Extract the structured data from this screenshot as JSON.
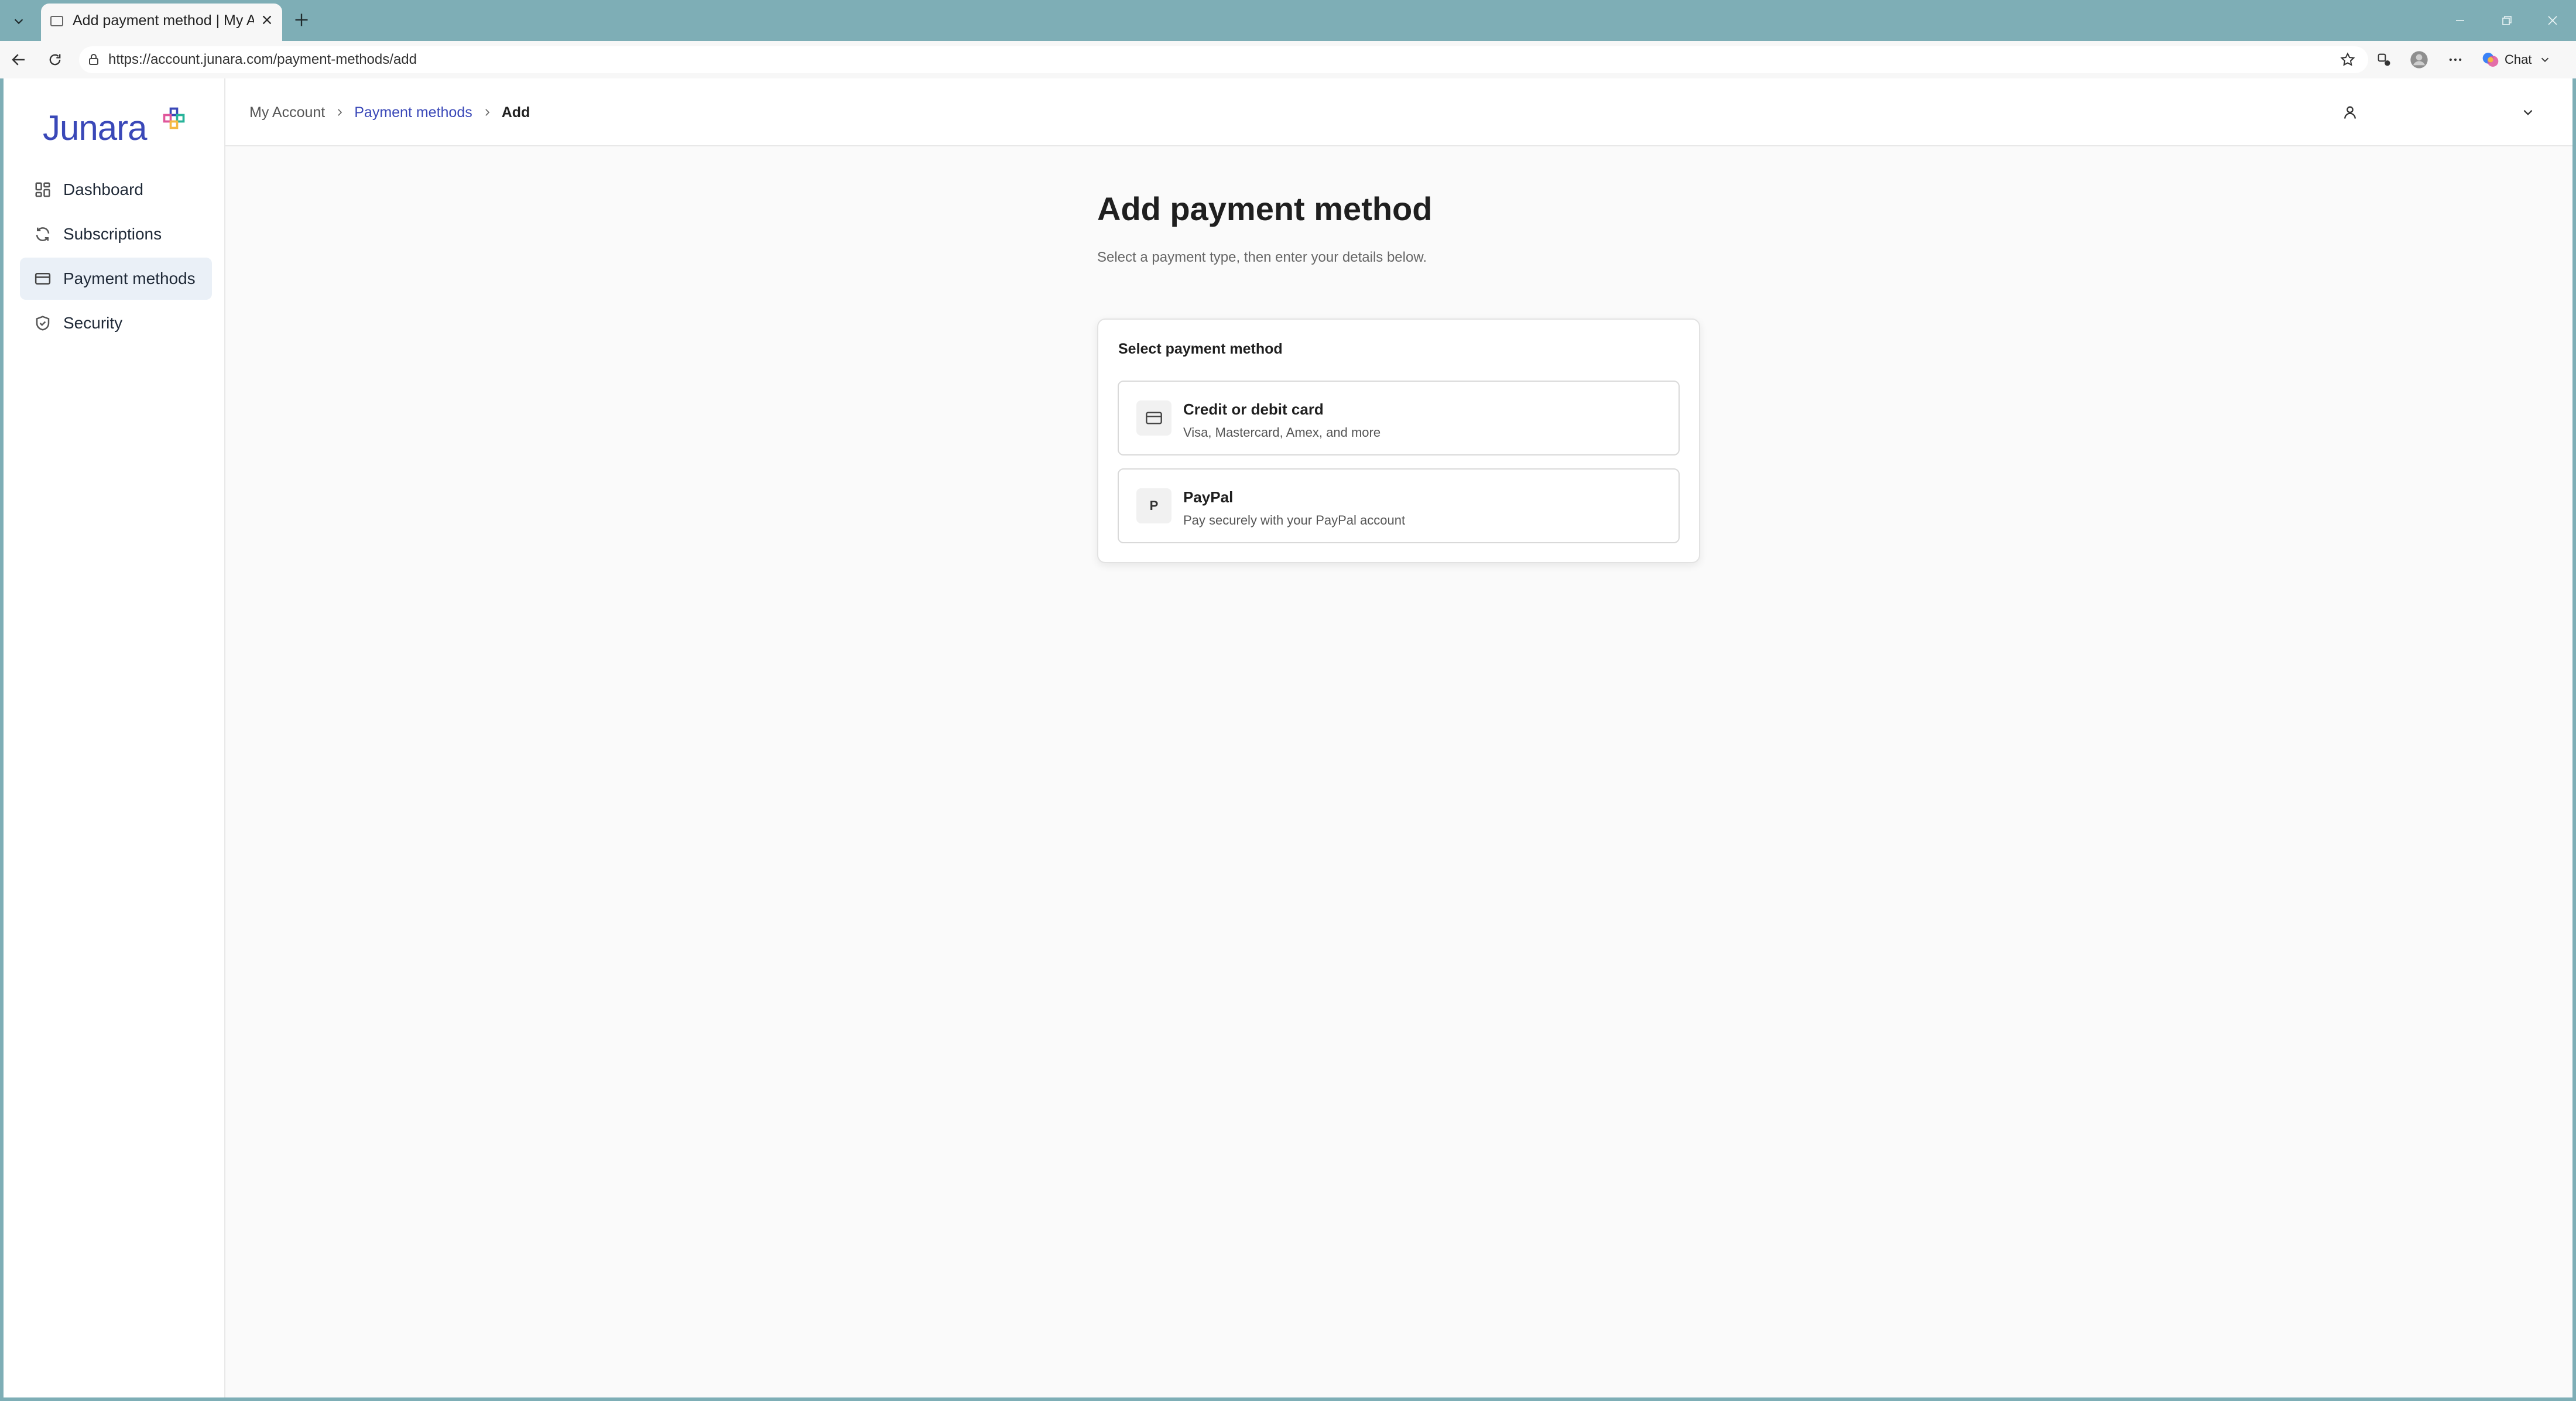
{
  "browser": {
    "tab_title": "Add payment method | My Account",
    "url": "https://account.junara.com/payment-methods/add",
    "chat_label": "Chat",
    "chrome_color": "#7eaeb6"
  },
  "sidebar": {
    "logo_text": "Junara",
    "brand_color": "#3a48b8",
    "items": [
      {
        "label": "Dashboard",
        "icon": "grid-icon",
        "active": false
      },
      {
        "label": "Subscriptions",
        "icon": "refresh-icon",
        "active": false
      },
      {
        "label": "Payment methods",
        "icon": "credit-card-icon",
        "active": true
      },
      {
        "label": "Security",
        "icon": "shield-icon",
        "active": false
      }
    ]
  },
  "breadcrumb": {
    "root": "My Account",
    "section": "Payment methods",
    "current": "Add"
  },
  "main": {
    "title": "Add payment method",
    "subtitle": "Select a payment type, then enter your details below.",
    "card_heading": "Select payment method",
    "options": [
      {
        "title": "Credit or debit card",
        "description": "Visa, Mastercard, Amex, and more",
        "icon": "credit-card-icon"
      },
      {
        "title": "PayPal",
        "description": "Pay securely with your PayPal account",
        "icon_letter": "P"
      }
    ]
  }
}
